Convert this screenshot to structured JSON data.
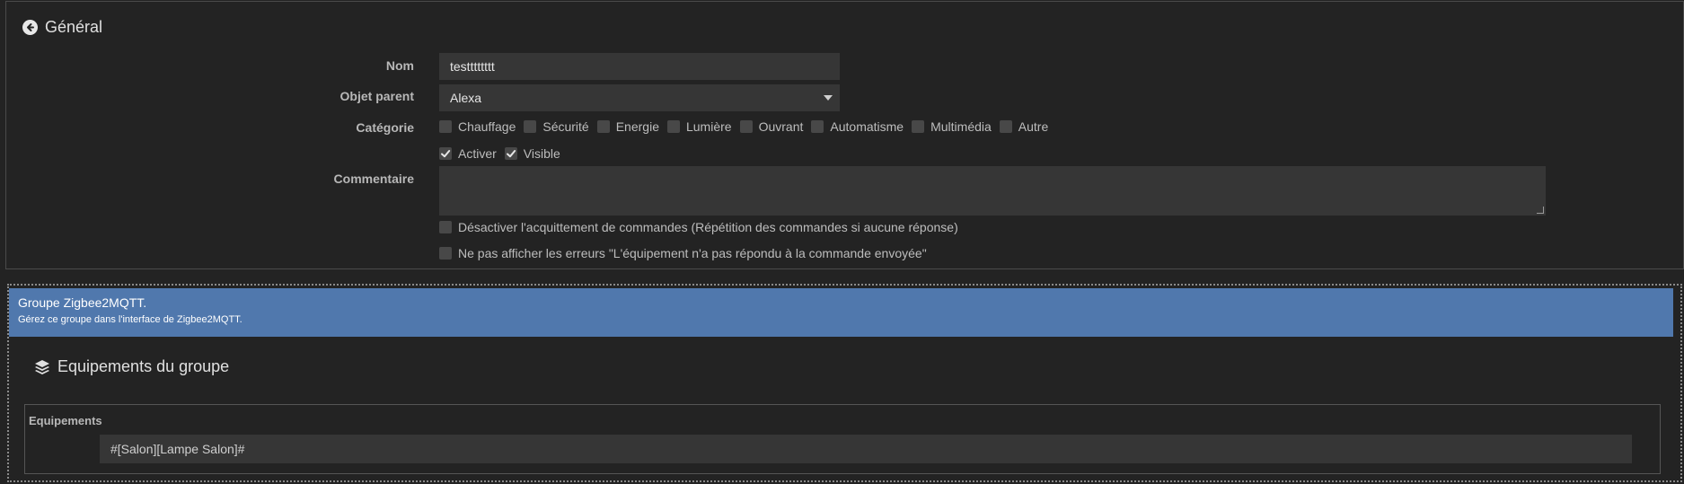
{
  "general": {
    "title": "Général",
    "fields": {
      "nom": {
        "label": "Nom",
        "value": "testttttttt"
      },
      "objet_parent": {
        "label": "Objet parent",
        "value": "Alexa"
      },
      "categorie": {
        "label": "Catégorie",
        "options": [
          "Chauffage",
          "Sécurité",
          "Energie",
          "Lumière",
          "Ouvrant",
          "Automatisme",
          "Multimédia",
          "Autre"
        ]
      },
      "activer": {
        "label": "Activer",
        "checked": true
      },
      "visible": {
        "label": "Visible",
        "checked": true
      },
      "commentaire": {
        "label": "Commentaire",
        "value": ""
      },
      "desactiver_ack": {
        "label": "Désactiver l'acquittement de commandes (Répétition des commandes si aucune réponse)",
        "checked": false
      },
      "ne_pas_afficher": {
        "label": "Ne pas afficher les erreurs \"L'équipement n'a pas répondu à la commande envoyée\"",
        "checked": false
      }
    }
  },
  "alert": {
    "title": "Groupe Zigbee2MQTT.",
    "subtitle": "Gérez ce groupe dans l'interface de Zigbee2MQTT."
  },
  "group": {
    "title": "Equipements du groupe",
    "equip_label": "Equipements",
    "equip_value": "#[Salon][Lampe Salon]#"
  },
  "colors": {
    "background": "#232323",
    "input": "#363636",
    "alert": "#5078ad"
  }
}
